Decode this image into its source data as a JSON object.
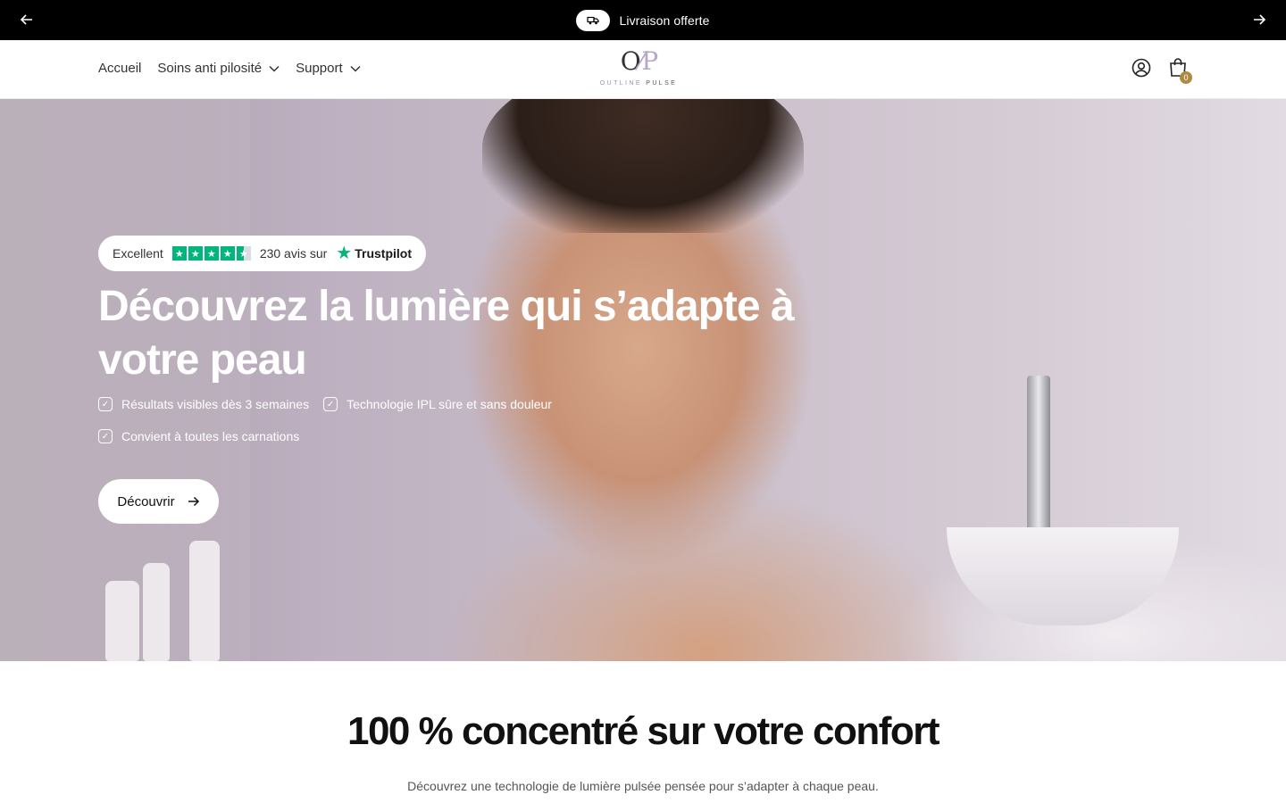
{
  "announcement": {
    "text": "Livraison offerte",
    "icon": "truck-icon"
  },
  "header": {
    "nav": [
      {
        "label": "Accueil",
        "has_dropdown": false
      },
      {
        "label": "Soins anti pilosité",
        "has_dropdown": true
      },
      {
        "label": "Support",
        "has_dropdown": true
      }
    ],
    "logo": {
      "mark_left": "O",
      "mark_right": "P",
      "word1": "OUTLINE",
      "word2": "PULSE"
    },
    "cart_count": "0",
    "icons": [
      "account-icon",
      "shopping-bag-icon"
    ]
  },
  "hero": {
    "trustpilot": {
      "rating_label": "Excellent",
      "stars": 4.5,
      "reviews_text": "230 avis sur",
      "brand": "Trustpilot"
    },
    "title": "Découvrez la lumière qui s’adapte à votre peau",
    "features": [
      "Résultats visibles dès 3 semaines",
      "Technologie IPL sûre et sans douleur",
      "Convient à toutes les carnations"
    ],
    "cta_label": "Découvrir"
  },
  "section": {
    "title": "100 % concentré sur votre confort",
    "subtitle": "Découvrez une technologie de lumière pulsée pensée pour s’adapter à chaque peau."
  },
  "colors": {
    "announcement_bg": "#000000",
    "trustpilot_green": "#00b67a",
    "cart_badge": "#b08a3e"
  }
}
